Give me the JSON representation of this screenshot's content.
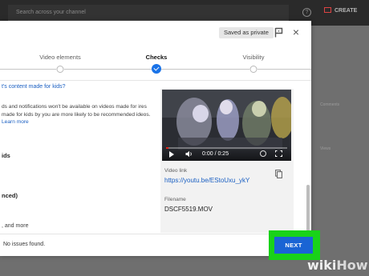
{
  "background": {
    "search_placeholder": "Search across your channel",
    "help_icon": "?",
    "create_label": "CREATE",
    "side_text_1": "Comments",
    "side_text_2": "Views"
  },
  "dialog": {
    "saved_chip": "Saved as private",
    "close_glyph": "×",
    "steps": [
      {
        "label": "Video elements",
        "state": "done"
      },
      {
        "label": "Checks",
        "state": "active"
      },
      {
        "label": "Visibility",
        "state": "upcoming"
      }
    ],
    "left": {
      "link_text": "t's content made for kids?",
      "paragraph_main": "ds and notifications won't be available on videos made for ires made for kids by you are more likely to be recommended ideos.",
      "paragraph_link": "Learn more",
      "kids_option": "ids",
      "advanced_option": "nced)",
      "more_text": ", and more"
    },
    "preview": {
      "time": "0:00 / 0:25",
      "progress_fraction": 0.02,
      "link_label": "Video link",
      "link_value": "https://youtu.be/EStoUxu_ykY",
      "filename_label": "Filename",
      "filename_value": "DSCF5519.MOV"
    },
    "footer": {
      "status": "No issues found.",
      "next_label": "NEXT"
    }
  },
  "colors": {
    "accent_blue": "#1a64d4",
    "highlight_green": "#19d219",
    "link_blue": "#1a5fc2"
  },
  "watermark": {
    "wiki": "wiki",
    "how": "How"
  }
}
